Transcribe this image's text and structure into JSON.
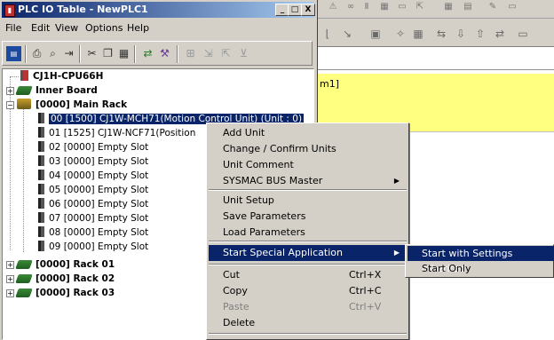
{
  "window": {
    "title": "PLC IO Table - NewPLC1",
    "minimize": "_",
    "maximize": "□",
    "close": "X"
  },
  "menubar": [
    "File",
    "Edit",
    "View",
    "Options",
    "Help"
  ],
  "toolbar_icons": [
    "io-table-icon",
    "print-icon",
    "print-preview-icon",
    "pin-icon",
    "cut-icon",
    "copy-icon",
    "paste-icon",
    "transfer-icon",
    "wrench-icon",
    "compare-icon",
    "transfer-to-plc-icon",
    "transfer-from-plc-icon",
    "verify-icon"
  ],
  "tree": {
    "cpu": "CJ1H-CPU66H",
    "inner_board": "Inner Board",
    "main_rack": "[0000] Main Rack",
    "slots": [
      "00 [1500] CJ1W-MCH71(Motion Control Unit) (Unit : 0)",
      "01 [1525] CJ1W-NCF71(Position",
      "02 [0000] Empty Slot",
      "03 [0000] Empty Slot",
      "04 [0000] Empty Slot",
      "05 [0000] Empty Slot",
      "06 [0000] Empty Slot",
      "07 [0000] Empty Slot",
      "08 [0000] Empty Slot",
      "09 [0000] Empty Slot"
    ],
    "racks": [
      "[0000] Rack 01",
      "[0000] Rack 02",
      "[0000] Rack 03"
    ],
    "expand_plus": "+",
    "expand_minus": "−"
  },
  "background": {
    "yellow_text": "m1]"
  },
  "context_menu": {
    "group1": [
      "Add Unit",
      "Change / Confirm Units",
      "Unit Comment",
      "SYSMAC BUS Master"
    ],
    "group2": [
      "Unit Setup",
      "Save Parameters",
      "Load Parameters"
    ],
    "group3": [
      "Start Special Application"
    ],
    "group4": [
      {
        "label": "Cut",
        "shortcut": "Ctrl+X"
      },
      {
        "label": "Copy",
        "shortcut": "Ctrl+C"
      },
      {
        "label": "Paste",
        "shortcut": "Ctrl+V"
      },
      {
        "label": "Delete",
        "shortcut": ""
      }
    ],
    "submenu_arrow": "▶"
  },
  "submenu": [
    "Start with Settings Inherited",
    "Start Only"
  ],
  "colors": {
    "selection": "#0a246a",
    "face": "#d4d0c8",
    "yellow_area": "#ffff80"
  }
}
